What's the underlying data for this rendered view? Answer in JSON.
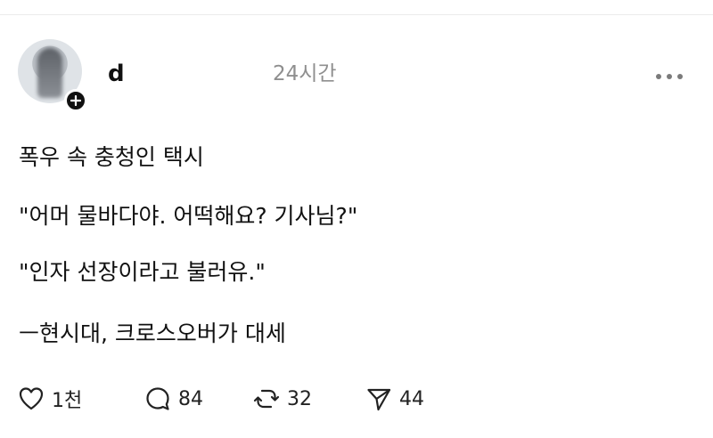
{
  "post": {
    "author": "d",
    "time": "24시간",
    "lines": [
      "폭우 속 충청인 택시",
      "\"어머 물바다야. 어떡해요? 기사님?\"",
      "\"인자 선장이라고 불러유.\"",
      "ㅡ현시대, 크로스오버가 대세"
    ]
  },
  "actions": {
    "likes": "1천",
    "replies": "84",
    "reposts": "32",
    "shares": "44"
  },
  "icons": {
    "like": "heart-icon",
    "reply": "speech-bubble-icon",
    "repost": "repost-icon",
    "share": "send-icon",
    "more": "more-icon",
    "follow": "plus-icon"
  }
}
